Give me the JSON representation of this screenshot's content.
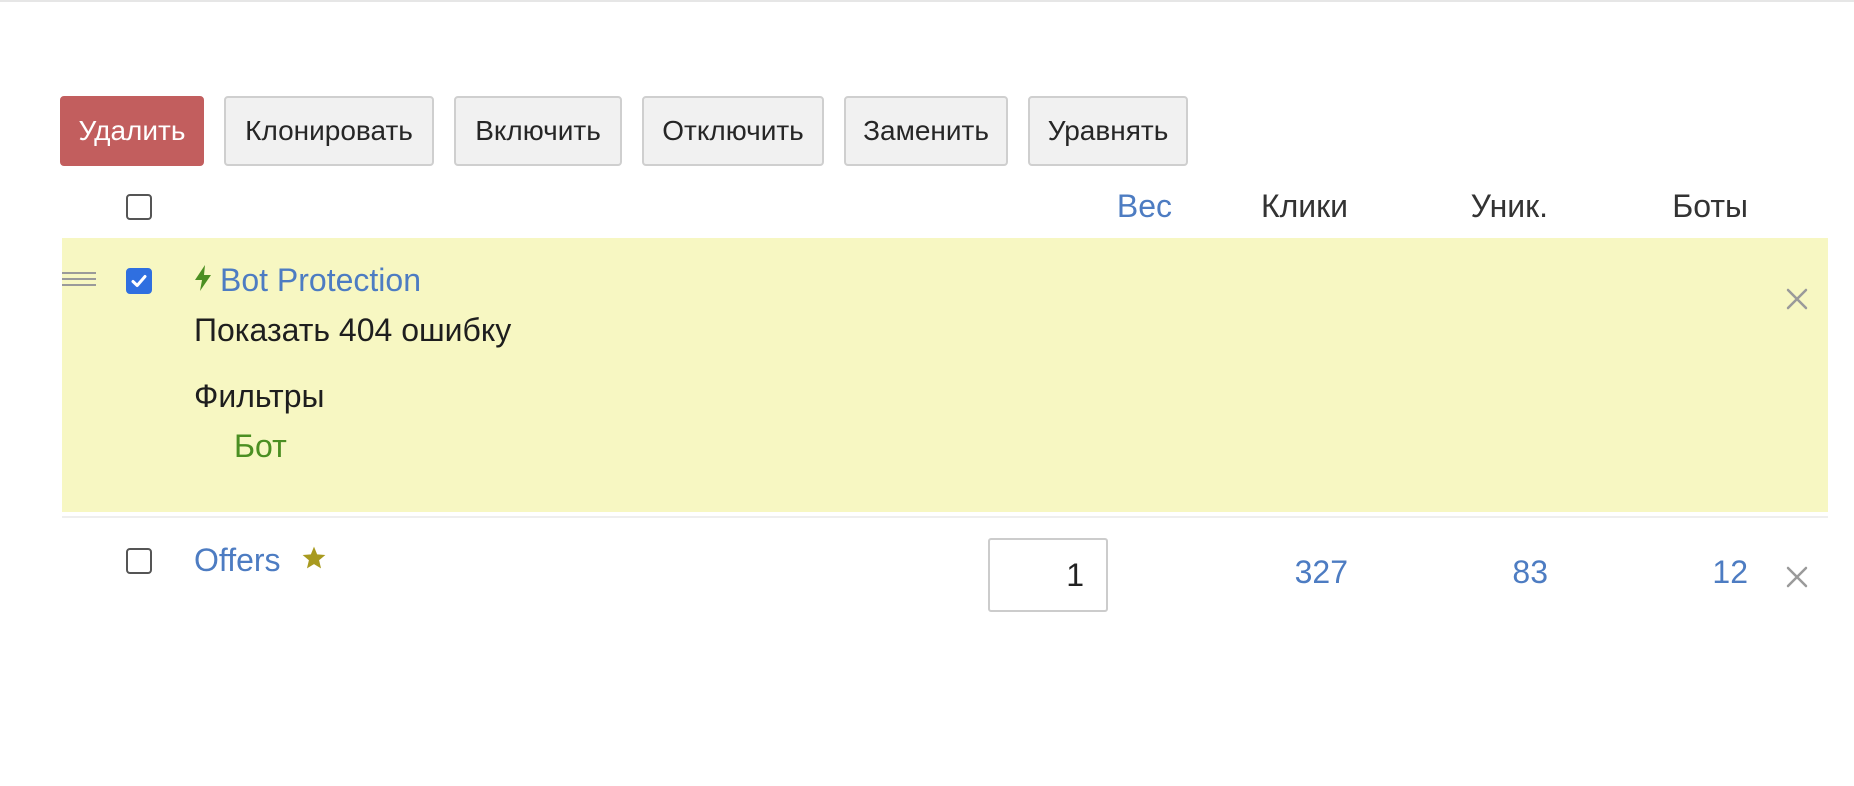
{
  "toolbar": {
    "delete_label": "Удалить",
    "clone_label": "Клонировать",
    "enable_label": "Включить",
    "disable_label": "Отключить",
    "replace_label": "Заменить",
    "equalize_label": "Уравнять"
  },
  "columns": {
    "weight": "Вес",
    "clicks": "Клики",
    "unique": "Уник.",
    "bots": "Боты"
  },
  "streams": [
    {
      "title": "Bot Protection",
      "icon": "lightning-icon",
      "checked": true,
      "action": "Показать 404 ошибку",
      "filters_label": "Фильтры",
      "filters": [
        "Бот"
      ],
      "background": "#f7f7c2"
    },
    {
      "title": "Offers",
      "icon": "star-icon",
      "checked": false,
      "weight": "1",
      "clicks": "327",
      "unique": "83",
      "bots": "12"
    }
  ],
  "colors": {
    "link": "#4d7cc2",
    "danger": "#c25e5e",
    "filter": "#4b8f22",
    "star": "#a89a1f",
    "highlight": "#f7f7c2"
  }
}
